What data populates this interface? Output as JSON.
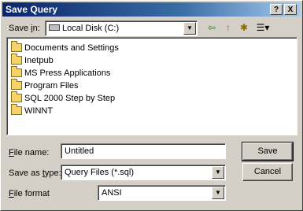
{
  "dialog": {
    "title": "Save Query",
    "help_label": "?",
    "close_label": "X"
  },
  "save_in": {
    "label_prefix": "Save ",
    "label_accel": "i",
    "label_suffix": "n:",
    "value": "Local Disk (C:)"
  },
  "toolbar": {
    "back_icon": "⇦",
    "up_icon": "↑",
    "new_folder_icon": "✱",
    "views_icon": "☰▾"
  },
  "folders": [
    {
      "name": "Documents and Settings"
    },
    {
      "name": "Inetpub"
    },
    {
      "name": "MS Press Applications"
    },
    {
      "name": "Program Files"
    },
    {
      "name": "SQL 2000 Step by Step"
    },
    {
      "name": "WINNT"
    }
  ],
  "file_name": {
    "label_accel": "F",
    "label_suffix": "ile name:",
    "value": "Untitled"
  },
  "save_as_type": {
    "label_prefix": "Save as ",
    "label_accel": "t",
    "label_suffix": "ype:",
    "value": "Query Files (*.sql)"
  },
  "file_format": {
    "label_accel": "F",
    "label_suffix": "ile format",
    "value": "ANSI"
  },
  "buttons": {
    "save": "Save",
    "cancel": "Cancel"
  }
}
